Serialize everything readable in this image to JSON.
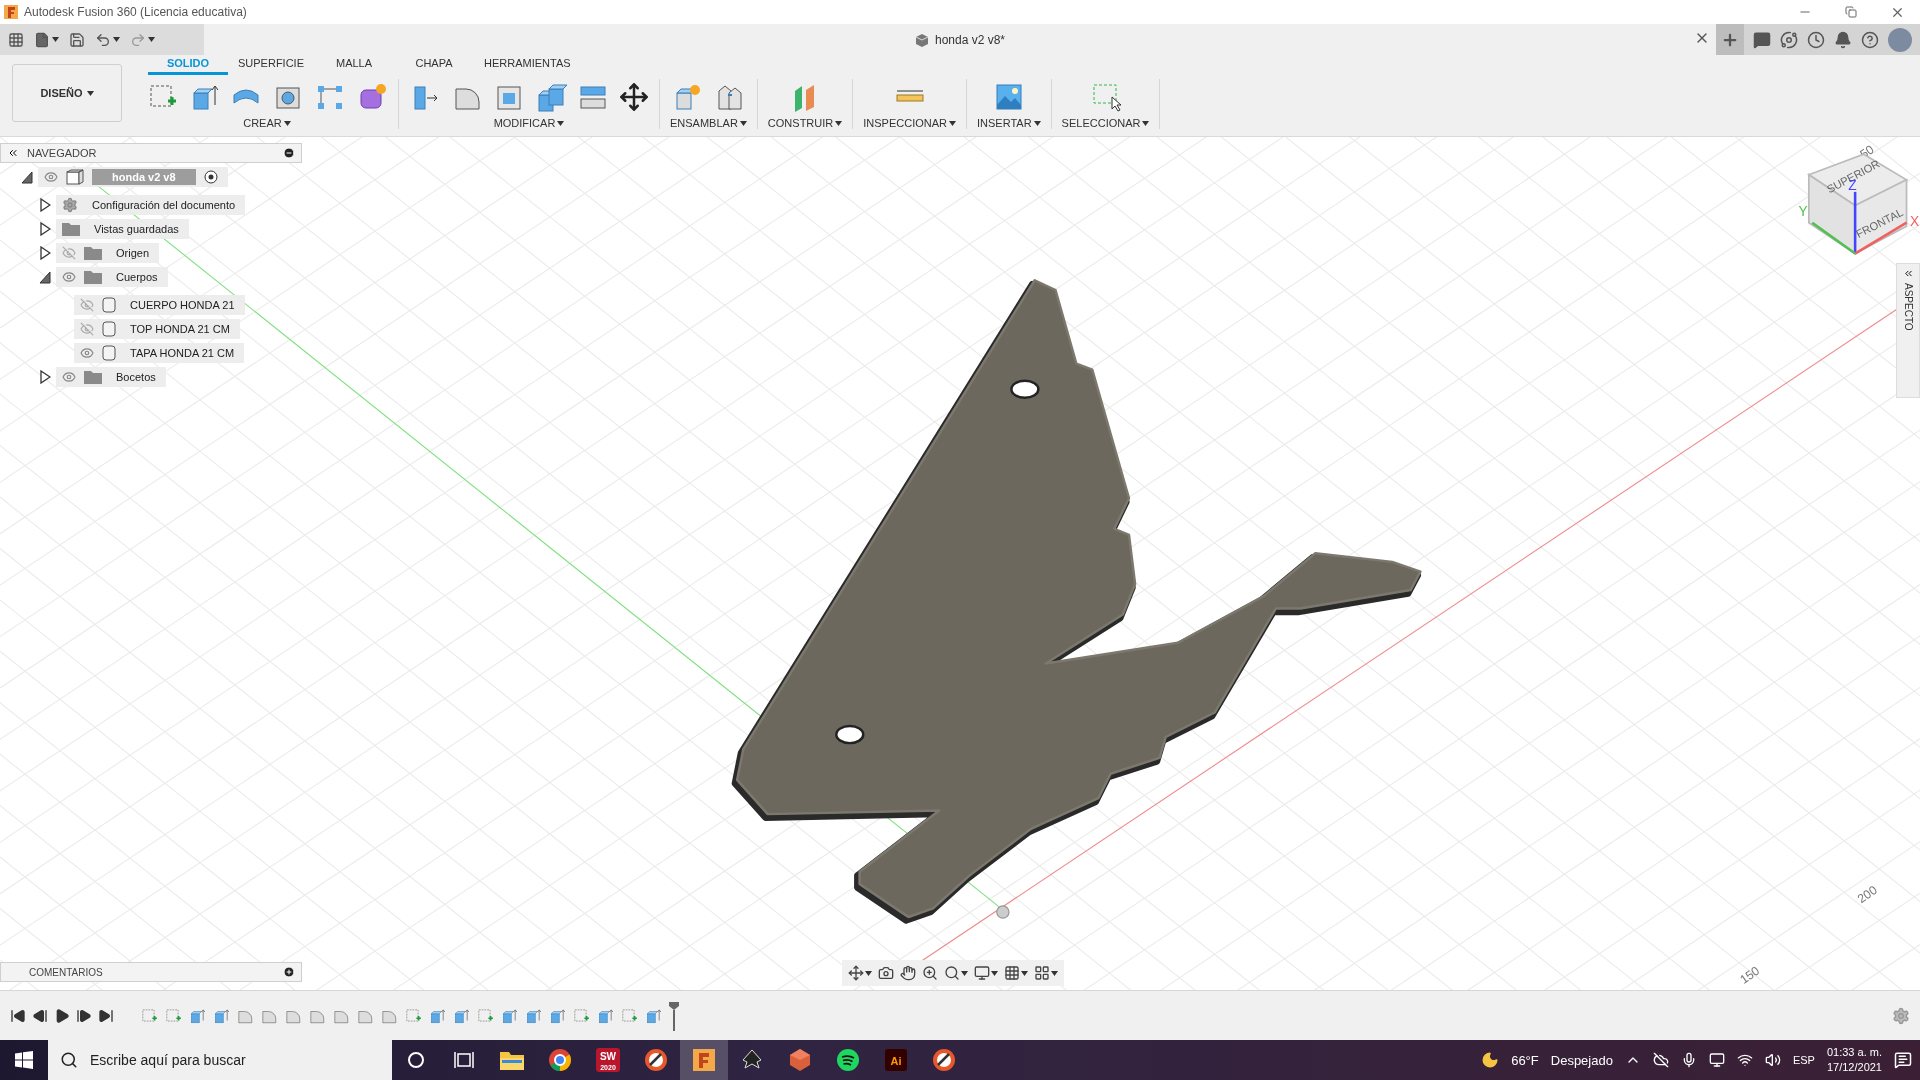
{
  "window": {
    "title": "Autodesk Fusion 360 (Licencia educativa)"
  },
  "document_tab": {
    "title": "honda v2 v8*"
  },
  "workspace": {
    "label": "DISEÑO"
  },
  "tabs": [
    {
      "label": "SOLIDO",
      "selected": true
    },
    {
      "label": "SUPERFICIE",
      "selected": false
    },
    {
      "label": "MALLA",
      "selected": false
    },
    {
      "label": "CHAPA",
      "selected": false
    },
    {
      "label": "HERRAMIENTAS",
      "selected": false
    }
  ],
  "tool_groups": [
    {
      "label": "CREAR"
    },
    {
      "label": "MODIFICAR"
    },
    {
      "label": "ENSAMBLAR"
    },
    {
      "label": "CONSTRUIR"
    },
    {
      "label": "INSPECCIONAR"
    },
    {
      "label": "INSERTAR"
    },
    {
      "label": "SELECCIONAR"
    }
  ],
  "navigator": {
    "title": "NAVEGADOR",
    "tree": [
      {
        "label": "honda v2 v8",
        "kind": "component",
        "expanded": true,
        "visible": true,
        "active": true,
        "children": [
          {
            "label": "Configuración del documento",
            "kind": "settings",
            "expanded": false
          },
          {
            "label": "Vistas guardadas",
            "kind": "folder",
            "expanded": false
          },
          {
            "label": "Origen",
            "kind": "folder",
            "expanded": false,
            "visible": false
          },
          {
            "label": "Cuerpos",
            "kind": "folder",
            "expanded": true,
            "visible": true,
            "children": [
              {
                "label": "CUERPO HONDA 21",
                "kind": "body",
                "visible": false
              },
              {
                "label": "TOP HONDA 21 CM",
                "kind": "body",
                "visible": false
              },
              {
                "label": "TAPA HONDA 21 CM",
                "kind": "body",
                "visible": true
              }
            ]
          },
          {
            "label": "Bocetos",
            "kind": "folder",
            "expanded": false,
            "visible": true
          }
        ]
      }
    ]
  },
  "viewport": {
    "grid_labels": [
      "50",
      "200",
      "150"
    ],
    "view_cube": {
      "faces": [
        "SUPERIOR",
        "FRONTAL"
      ],
      "axes": [
        "X",
        "Y",
        "Z"
      ]
    }
  },
  "aspect_panel": {
    "title": "ASPECTO"
  },
  "comments_panel": {
    "title": "COMENTARIOS"
  },
  "timeline": {
    "features": [
      {
        "kind": "sketch"
      },
      {
        "kind": "sketch"
      },
      {
        "kind": "extrude"
      },
      {
        "kind": "extrude"
      },
      {
        "kind": "fillet"
      },
      {
        "kind": "fillet"
      },
      {
        "kind": "fillet"
      },
      {
        "kind": "fillet"
      },
      {
        "kind": "fillet"
      },
      {
        "kind": "fillet"
      },
      {
        "kind": "fillet"
      },
      {
        "kind": "sketch"
      },
      {
        "kind": "extrude"
      },
      {
        "kind": "extrude"
      },
      {
        "kind": "sketch"
      },
      {
        "kind": "extrude"
      },
      {
        "kind": "extrude"
      },
      {
        "kind": "extrude"
      },
      {
        "kind": "sketch"
      },
      {
        "kind": "extrude"
      },
      {
        "kind": "sketch"
      },
      {
        "kind": "extrude"
      }
    ]
  },
  "taskbar": {
    "search": {
      "placeholder": "Escribe aquí para buscar"
    },
    "apps": [
      {
        "kind": "cortana",
        "selected": false
      },
      {
        "kind": "task-view",
        "selected": false
      },
      {
        "kind": "explorer",
        "selected": false
      },
      {
        "kind": "chrome",
        "selected": false
      },
      {
        "kind": "solidworks",
        "label": "SW",
        "sublabel": "2020",
        "selected": false
      },
      {
        "kind": "orange-app",
        "selected": false
      },
      {
        "kind": "fusion",
        "selected": true
      },
      {
        "kind": "inkscape",
        "selected": false
      },
      {
        "kind": "gem",
        "selected": false
      },
      {
        "kind": "spotify",
        "selected": false
      },
      {
        "kind": "illustrator",
        "label": "Ai",
        "selected": false
      },
      {
        "kind": "orange-app",
        "selected": false
      }
    ],
    "weather": {
      "temperature": "66°F",
      "condition": "Despejado"
    },
    "language": "ESP",
    "time": "01:33 a. m.",
    "date": "17/12/2021"
  }
}
